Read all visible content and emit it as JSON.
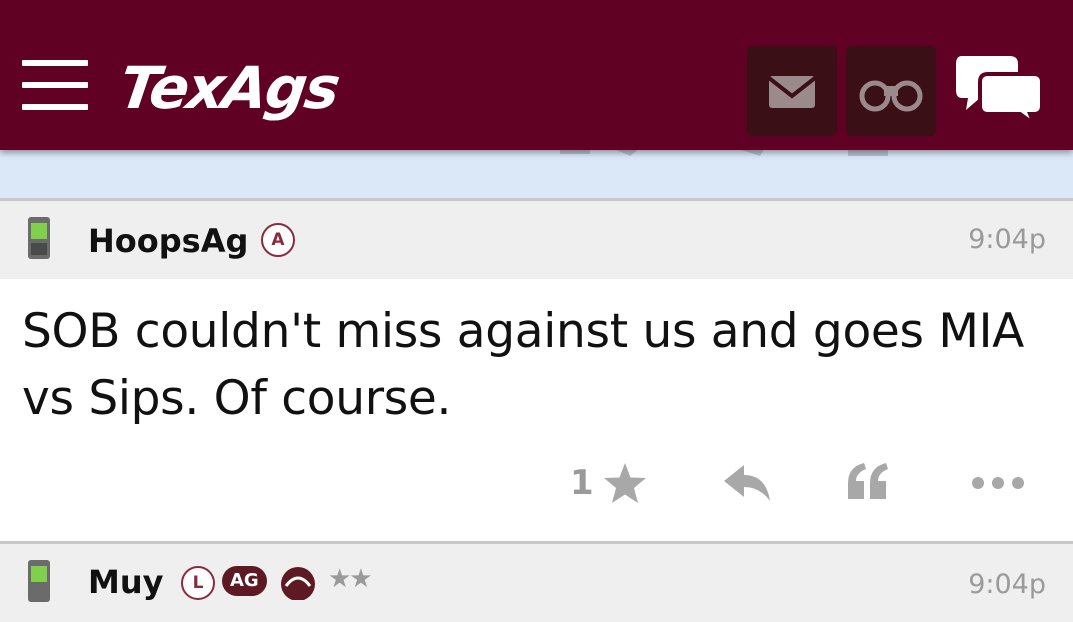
{
  "header": {
    "logo_text": "TexAgs",
    "background": "#600023",
    "icons": [
      "menu-icon",
      "mail-icon",
      "binoculars-icon",
      "chat-icon"
    ]
  },
  "posts": [
    {
      "username": "HoopsAg",
      "badges": [
        "A"
      ],
      "time": "9:04p",
      "body": "SOB couldn't miss against us and goes MIA vs Sips. Of course.",
      "star_count": "1"
    },
    {
      "username": "Muy",
      "badges": [
        "L",
        "AG"
      ],
      "stars": "★★",
      "time": "9:04p"
    }
  ],
  "colors": {
    "accent": "#600023",
    "icon_gray": "#a8a8a8",
    "previous_post_bg": "#dbe8f7"
  }
}
